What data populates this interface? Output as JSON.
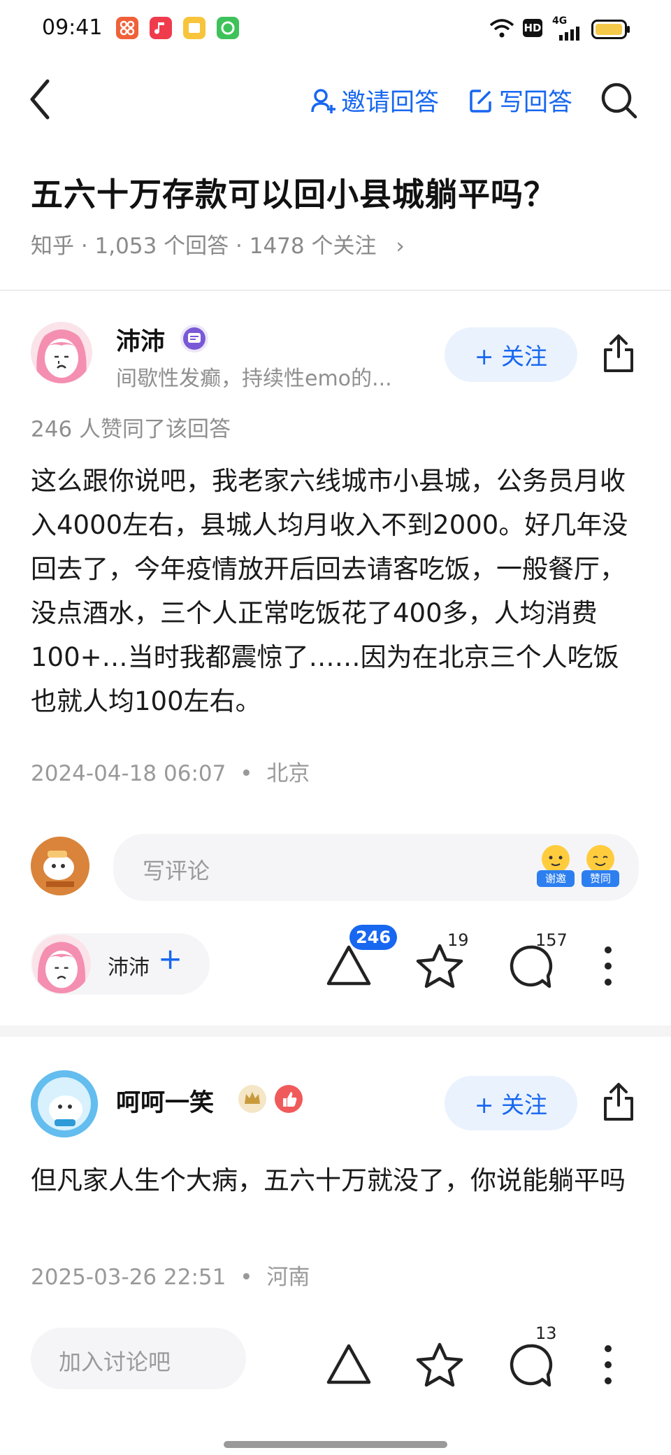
{
  "status_bar": {
    "time": "09:41",
    "network": "4G",
    "hd_label": "HD",
    "app_icons": [
      "app-orange-icon",
      "music-red-icon",
      "note-yellow-icon",
      "chat-green-icon"
    ]
  },
  "nav": {
    "invite_label": "邀请回答",
    "write_label": "写回答"
  },
  "question": {
    "title": "五六十万存款可以回小县城躺平吗？",
    "meta": "知乎 · 1,053 个回答 · 1478 个关注",
    "meta_chevron": "›"
  },
  "answer": {
    "author": "沛沛",
    "bio": "间歇性发癫，持续性emo的...",
    "follow_label": "+ 关注",
    "likes_text": "246 人赞同了该回答",
    "content": "这么跟你说吧，我老家六线城市小县城，公务员月收入4000左右，县城人均月收入不到2000。好几年没回去了，今年疫情放开后回去请客吃饭，一般餐厅，没点酒水，三个人正常吃饭花了400多，人均消费100+…当时我都震惊了……因为在北京三个人吃饭也就人均100左右。",
    "time": "2024-04-18 06:07",
    "dot": "•",
    "location": "北京",
    "comment_placeholder": "写评论",
    "sticker_thanks": "谢邀",
    "sticker_agree": "赞同",
    "bottom_author": "沛沛",
    "bottom_plus": "+",
    "upvote_count": "246",
    "favorite_count": "19",
    "comment_count": "157"
  },
  "comment": {
    "author": "呵呵一笑",
    "follow_label": "+ 关注",
    "content": "但凡家人生个大病，五六十万就没了，你说能躺平吗",
    "time": "2025-03-26 22:51",
    "dot": "•",
    "location": "河南",
    "input_placeholder": "加入讨论吧",
    "comment_count": "13"
  },
  "colors": {
    "accent": "#1767f0",
    "badge": "#1767f0",
    "gray_text": "#8a8a8a"
  }
}
